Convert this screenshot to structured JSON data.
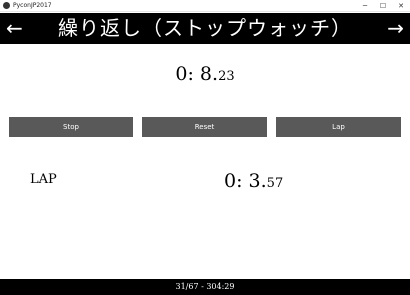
{
  "window": {
    "title": "PyconJP2017",
    "controls": {
      "minimize": "─",
      "maximize": "☐",
      "close": "✕"
    }
  },
  "header": {
    "title": "繰り返し（ストップウォッチ）",
    "prev_arrow": "←",
    "next_arrow": "→",
    "background": "#000000"
  },
  "timer": {
    "main": "0: 8.",
    "fraction": "23"
  },
  "buttons": {
    "stop": "Stop",
    "reset": "Reset",
    "lap": "Lap",
    "color": "#595959"
  },
  "lap": {
    "label": "LAP",
    "main": "0: 3.",
    "fraction": "57"
  },
  "footer": {
    "text": "31/67 - 304:29"
  }
}
